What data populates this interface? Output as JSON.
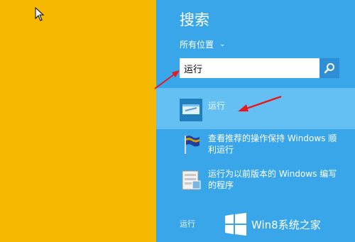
{
  "search": {
    "title": "搜索",
    "scope_label": "所有位置",
    "query": "运行"
  },
  "results": [
    {
      "label": "运行"
    },
    {
      "label": "查看推荐的操作保持 Windows 顺利运行"
    },
    {
      "label": "运行为以前版本的 Windows 编写的程序"
    }
  ],
  "footer": {
    "label": "运行"
  },
  "watermark": {
    "text": "Win8系统之家"
  },
  "colors": {
    "desktop": "#f6b800",
    "pane": "#3aa6ea",
    "selected": "#64c0f2",
    "arrow": "#e8191c"
  }
}
